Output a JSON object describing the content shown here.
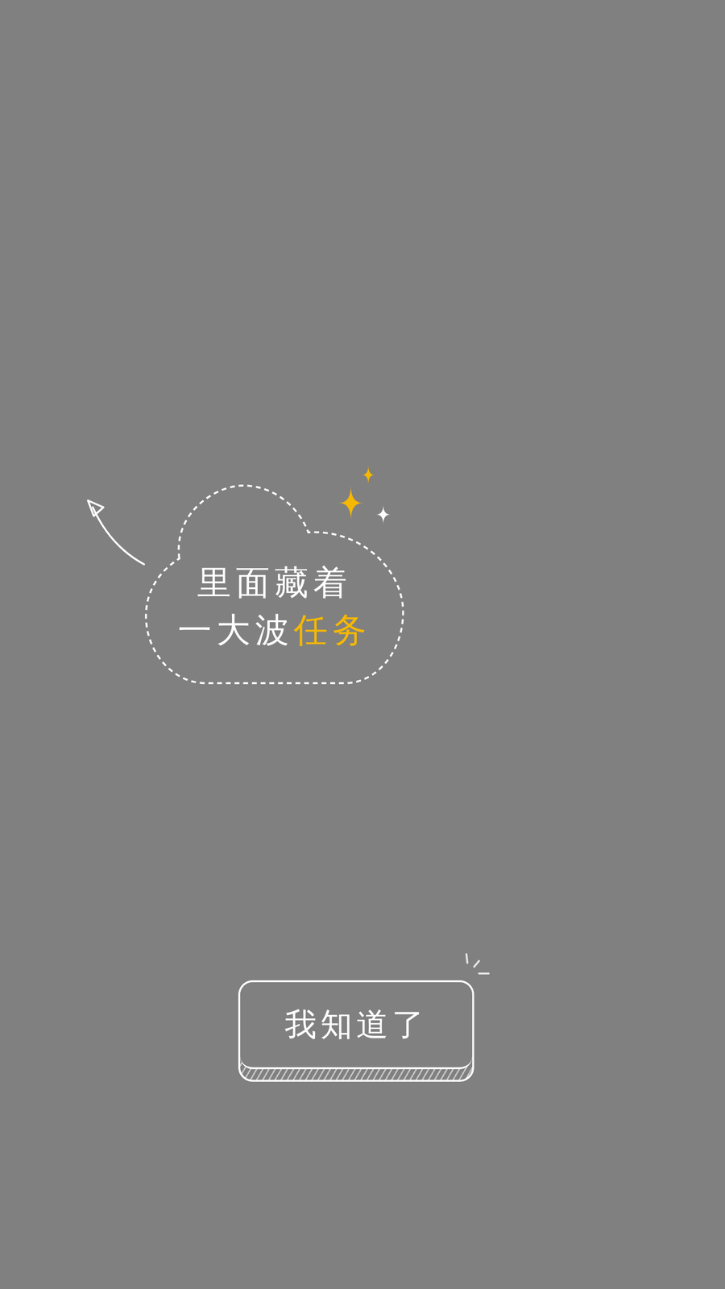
{
  "tip": {
    "lines": [
      [
        {
          "text": "里面藏着",
          "highlight": false
        }
      ],
      [
        {
          "text": "一大波",
          "highlight": false
        },
        {
          "text": "任务",
          "highlight": true
        }
      ]
    ]
  },
  "button": {
    "label": "我知道了"
  }
}
